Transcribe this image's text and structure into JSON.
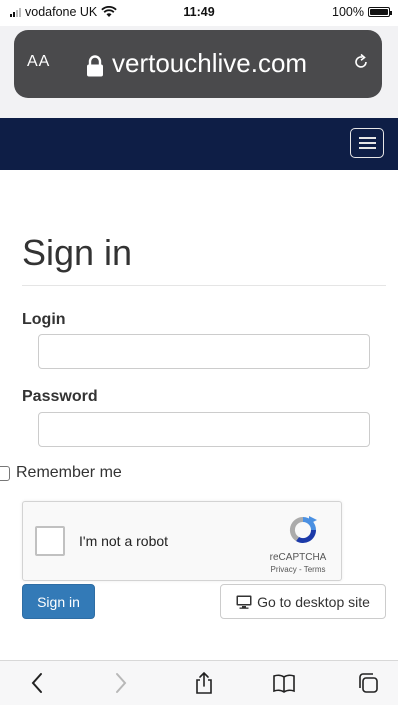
{
  "status_bar": {
    "carrier": "vodafone UK",
    "time": "11:49",
    "battery": "100%",
    "battery_level": 1.0
  },
  "browser": {
    "text_size_label": "AA",
    "url": "vertouchlive.com"
  },
  "page": {
    "title": "Sign in",
    "login_label": "Login",
    "login_value": "",
    "password_label": "Password",
    "password_value": "",
    "remember_label": "Remember me",
    "remember_checked": false
  },
  "recaptcha": {
    "label": "I'm not a robot",
    "brand": "reCAPTCHA",
    "links": "Privacy - Terms"
  },
  "buttons": {
    "sign_in": "Sign in",
    "desktop": "Go to desktop site"
  },
  "toolbar": {
    "items": [
      "back-icon",
      "forward-icon",
      "share-icon",
      "bookmarks-icon",
      "tabs-icon"
    ]
  },
  "colors": {
    "navbar": "#0e1e46",
    "primary_button": "#337ab7",
    "url_bar": "#4a4a4c"
  }
}
